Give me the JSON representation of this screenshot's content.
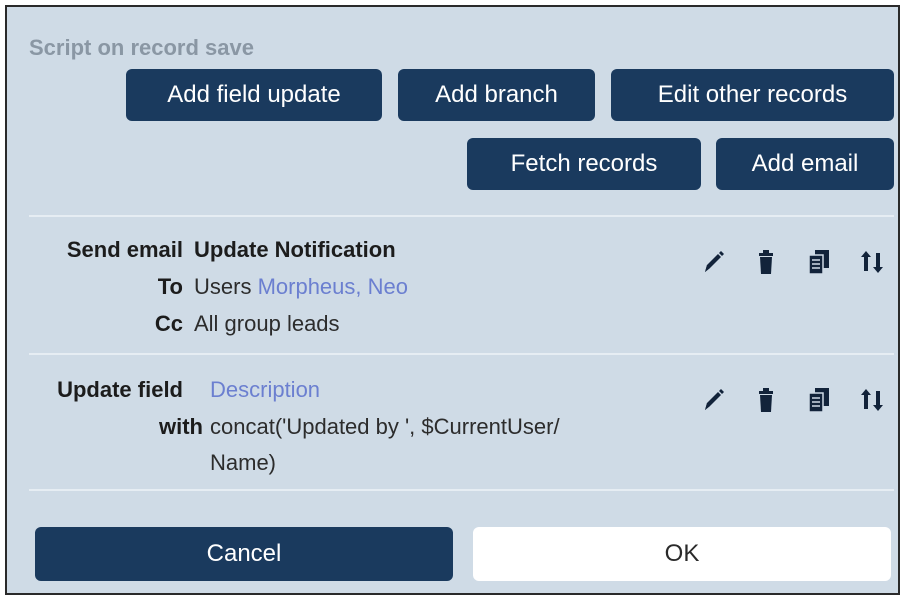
{
  "header": {
    "title": "Script on record save"
  },
  "buttons": {
    "add_field_update": "Add field update",
    "add_branch": "Add branch",
    "edit_other_records": "Edit other records",
    "fetch_records": "Fetch records",
    "add_email": "Add email"
  },
  "actions": [
    {
      "label": "Send email",
      "value": "Update Notification",
      "rows": [
        {
          "label": "To",
          "prefix": "Users",
          "link": "Morpheus, Neo"
        },
        {
          "label": "Cc",
          "prefix": "All group leads"
        }
      ],
      "icons": [
        "pencil-icon",
        "trash-icon",
        "copy-icon",
        "sort-icon"
      ]
    },
    {
      "label": "Update field",
      "value": "Description",
      "rows": [
        {
          "label": "with",
          "line1": "concat('Updated by ', $CurrentUser/",
          "line2": "Name)"
        }
      ],
      "icons": [
        "pencil-icon",
        "trash-icon",
        "copy-icon",
        "sort-icon"
      ]
    }
  ],
  "footer": {
    "cancel_label": "Cancel",
    "ok_label": "OK"
  },
  "colors": {
    "accent": "#1a3a5e",
    "panel": "#cfdbe6",
    "link": "#6b7fd0"
  }
}
